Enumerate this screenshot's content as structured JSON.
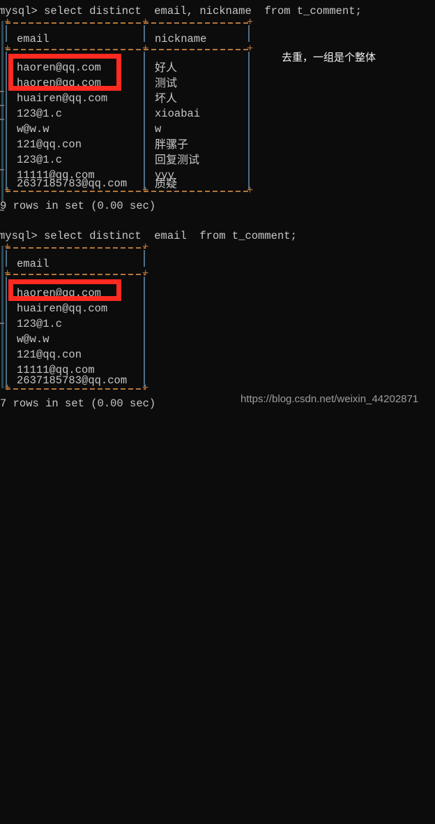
{
  "terminal": {
    "background": "#0c0c0c",
    "text_color": "#c6c6c6",
    "border_color": "#b5763a",
    "highlight_color": "#ff2a20"
  },
  "query1": {
    "prompt": "mysql> select distinct  email, nickname  from t_comment;",
    "columns": [
      "email",
      "nickname"
    ],
    "rows": [
      {
        "email": "haoren@qq.com",
        "nickname": "好人"
      },
      {
        "email": "haoren@qq.com",
        "nickname": "测试"
      },
      {
        "email": "huairen@qq.com",
        "nickname": "坏人"
      },
      {
        "email": "123@1.c",
        "nickname": "xioabai"
      },
      {
        "email": "w@w.w",
        "nickname": "w"
      },
      {
        "email": "121@qq.con",
        "nickname": "胖骡子"
      },
      {
        "email": "123@1.c",
        "nickname": "回复测试"
      },
      {
        "email": "11111@qq.com",
        "nickname": "yyy"
      },
      {
        "email": "2637185783@qq.com",
        "nickname": "质疑"
      }
    ],
    "result_status": "9 rows in set (0.00 sec)"
  },
  "query2": {
    "prompt": "mysql> select distinct  email  from t_comment;",
    "columns": [
      "email"
    ],
    "rows": [
      {
        "email": "haoren@qq.com"
      },
      {
        "email": "huairen@qq.com"
      },
      {
        "email": "123@1.c"
      },
      {
        "email": "w@w.w"
      },
      {
        "email": "121@qq.con"
      },
      {
        "email": "11111@qq.com"
      },
      {
        "email": "2637185783@qq.com"
      }
    ],
    "result_status": "7 rows in set (0.00 sec)"
  },
  "annotation": {
    "note": "去重，一组是个整体"
  },
  "watermark": {
    "url": "https://blog.csdn.net/weixin_44202871"
  }
}
